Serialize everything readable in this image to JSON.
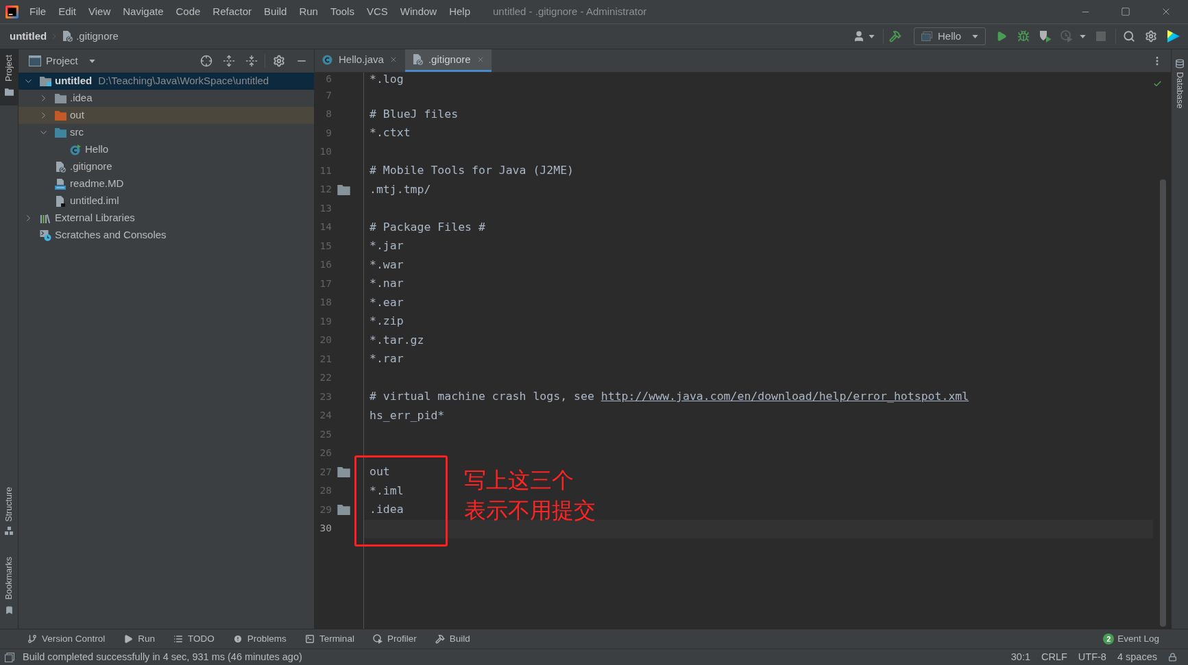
{
  "title_bar": {
    "menu": [
      "File",
      "Edit",
      "View",
      "Navigate",
      "Code",
      "Refactor",
      "Build",
      "Run",
      "Tools",
      "VCS",
      "Window",
      "Help"
    ],
    "title": "untitled - .gitignore - Administrator"
  },
  "nav_bar": {
    "breadcrumbs": [
      {
        "label": "untitled"
      },
      {
        "label": ".gitignore"
      }
    ],
    "run_config": "Hello"
  },
  "left_stripe": {
    "top": [
      {
        "label": "Project",
        "selected": true
      }
    ],
    "bottom": [
      {
        "label": "Structure",
        "selected": false
      },
      {
        "label": "Bookmarks",
        "selected": false
      }
    ]
  },
  "project_panel": {
    "title": "Project",
    "tree": [
      {
        "name": "untitled",
        "path": "D:\\Teaching\\Java\\WorkSpace\\untitled",
        "kind": "module",
        "expanded": true,
        "selected": true,
        "highlighted": false,
        "children": [
          {
            "name": ".idea",
            "kind": "folder",
            "expanded": false,
            "selected": false,
            "highlighted": false
          },
          {
            "name": "out",
            "kind": "excluded_folder",
            "expanded": false,
            "selected": false,
            "highlighted": true
          },
          {
            "name": "src",
            "kind": "source_folder",
            "expanded": true,
            "selected": false,
            "highlighted": false,
            "children": [
              {
                "name": "Hello",
                "kind": "class",
                "selected": false,
                "highlighted": false
              }
            ]
          },
          {
            "name": ".gitignore",
            "kind": "ignore_file",
            "selected": false,
            "highlighted": false
          },
          {
            "name": "readme.MD",
            "kind": "markdown",
            "selected": false,
            "highlighted": false
          },
          {
            "name": "untitled.iml",
            "kind": "module_file",
            "selected": false,
            "highlighted": false
          }
        ]
      },
      {
        "name": "External Libraries",
        "kind": "libraries",
        "expanded": false,
        "selected": false,
        "highlighted": false
      },
      {
        "name": "Scratches and Consoles",
        "kind": "scratches",
        "selected": false,
        "highlighted": false
      }
    ]
  },
  "editor": {
    "tabs": [
      {
        "label": "Hello.java",
        "kind": "java",
        "selected": false
      },
      {
        "label": ".gitignore",
        "kind": "ignore",
        "selected": true
      }
    ],
    "lines": [
      {
        "number": "6",
        "text": "*.log",
        "folder": false,
        "current": false
      },
      {
        "number": "7",
        "folder": false,
        "current": false
      },
      {
        "number": "8",
        "text": "# BlueJ files",
        "folder": false,
        "current": false
      },
      {
        "number": "9",
        "text": "*.ctxt",
        "folder": false,
        "current": false
      },
      {
        "number": "10",
        "folder": false,
        "current": false
      },
      {
        "number": "11",
        "text": "# Mobile Tools for Java (J2ME)",
        "folder": false,
        "current": false
      },
      {
        "number": "12",
        "text": ".mtj.tmp/",
        "folder": true,
        "current": false
      },
      {
        "number": "13",
        "folder": false,
        "current": false
      },
      {
        "number": "14",
        "text": "# Package Files #",
        "folder": false,
        "current": false
      },
      {
        "number": "15",
        "text": "*.jar",
        "folder": false,
        "current": false
      },
      {
        "number": "16",
        "text": "*.war",
        "folder": false,
        "current": false
      },
      {
        "number": "17",
        "text": "*.nar",
        "folder": false,
        "current": false
      },
      {
        "number": "18",
        "text": "*.ear",
        "folder": false,
        "current": false
      },
      {
        "number": "19",
        "text": "*.zip",
        "folder": false,
        "current": false
      },
      {
        "number": "20",
        "text": "*.tar.gz",
        "folder": false,
        "current": false
      },
      {
        "number": "21",
        "text": "*.rar",
        "folder": false,
        "current": false
      },
      {
        "number": "22",
        "folder": false,
        "current": false
      },
      {
        "number": "23",
        "text": "# virtual machine crash logs, see ",
        "link": "http://www.java.com/en/download/help/error_hotspot.xml",
        "folder": false,
        "current": false
      },
      {
        "number": "24",
        "text": "hs_err_pid*",
        "folder": false,
        "current": false
      },
      {
        "number": "25",
        "folder": false,
        "current": false
      },
      {
        "number": "26",
        "folder": false,
        "current": false
      },
      {
        "number": "27",
        "text": "out",
        "folder": true,
        "current": false
      },
      {
        "number": "28",
        "text": "*.iml",
        "folder": false,
        "current": false
      },
      {
        "number": "29",
        "text": ".idea",
        "folder": true,
        "current": false
      },
      {
        "number": "30",
        "folder": false,
        "current": true
      }
    ],
    "annotation": {
      "lines": [
        "写上这三个",
        "表示不用提交"
      ]
    }
  },
  "right_stripe": [
    {
      "label": "Database",
      "selected": false
    }
  ],
  "tool_windows": [
    {
      "label": "Version Control"
    },
    {
      "label": "Run"
    },
    {
      "label": "TODO"
    },
    {
      "label": "Problems"
    },
    {
      "label": "Terminal"
    },
    {
      "label": "Profiler"
    },
    {
      "label": "Build"
    }
  ],
  "event_log": {
    "label": "Event Log",
    "count": "2"
  },
  "status_bar": {
    "message": "Build completed successfully in 4 sec, 931 ms (46 minutes ago)",
    "widgets": [
      "30:1",
      "CRLF",
      "UTF-8",
      "4 spaces"
    ]
  }
}
